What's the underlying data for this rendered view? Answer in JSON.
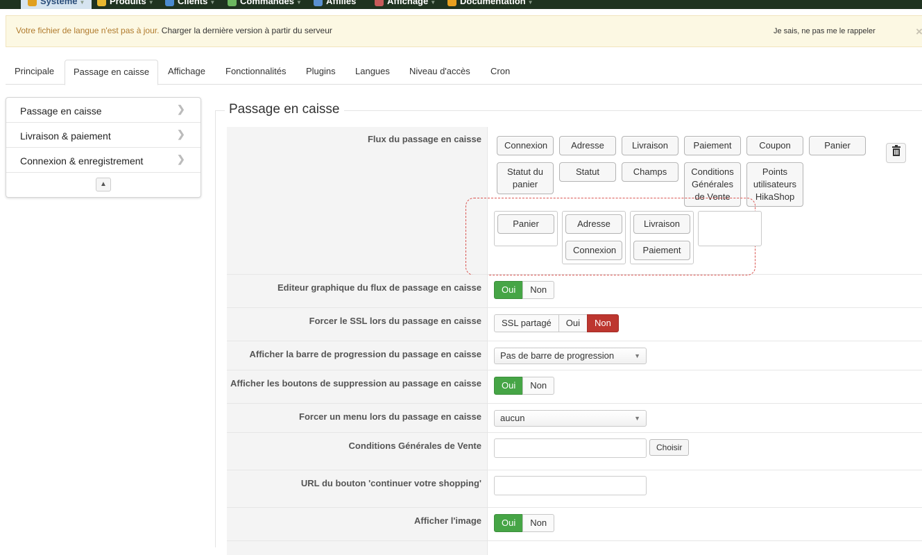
{
  "topmenu": [
    {
      "label": "Système",
      "color": "#e0a020"
    },
    {
      "label": "Produits",
      "color": "#e8b830"
    },
    {
      "label": "Clients",
      "color": "#4a8ad0"
    },
    {
      "label": "Commandes",
      "color": "#6cb860"
    },
    {
      "label": "Affiliés",
      "color": "#5a90d0"
    },
    {
      "label": "Affichage",
      "color": "#c85a5a"
    },
    {
      "label": "Documentation",
      "color": "#e8a020"
    }
  ],
  "alert": {
    "msg_highlight": "Votre fichier de langue n'est pas à jour.",
    "msg_rest": " Charger la dernière version à partir du serveur",
    "dismiss": "Je sais, ne pas me le rappeler",
    "close": "×"
  },
  "tabs": [
    "Principale",
    "Passage en caisse",
    "Affichage",
    "Fonctionnalités",
    "Plugins",
    "Langues",
    "Niveau d'accès",
    "Cron"
  ],
  "sidenav": {
    "items": [
      "Passage en caisse",
      "Livraison & paiement",
      "Connexion & enregistrement"
    ],
    "chevron": "❯",
    "collapse": "▲"
  },
  "section_title": "Passage en caisse",
  "flux": {
    "label": "Flux du passage en caisse",
    "palette_row1": [
      "Connexion",
      "Adresse",
      "Livraison",
      "Paiement",
      "Coupon",
      "Panier"
    ],
    "palette_row2": [
      "Statut du panier",
      "Statut",
      "Champs",
      "Conditions Générales de Vente",
      "Points utilisateurs HikaShop"
    ],
    "steps": {
      "step1": [
        "Panier"
      ],
      "step2": [
        "Adresse",
        "Connexion"
      ],
      "step3": [
        "Livraison",
        "Paiement"
      ]
    }
  },
  "rows": {
    "editeur": {
      "label": "Editeur graphique du flux de passage en caisse",
      "options": [
        "Oui",
        "Non"
      ],
      "active": "Oui"
    },
    "ssl": {
      "label": "Forcer le SSL lors du passage en caisse",
      "options": [
        "SSL partagé",
        "Oui",
        "Non"
      ],
      "active": "Non"
    },
    "progression": {
      "label": "Afficher la barre de progression du passage en caisse",
      "value": "Pas de barre de progression"
    },
    "suppression": {
      "label": "Afficher les boutons de suppression au passage en caisse",
      "options": [
        "Oui",
        "Non"
      ],
      "active": "Oui"
    },
    "menu": {
      "label": "Forcer un menu lors du passage en caisse",
      "value": "aucun"
    },
    "cgv": {
      "label": "Conditions Générales de Vente",
      "value": "",
      "button": "Choisir"
    },
    "url": {
      "label": "URL du bouton 'continuer votre shopping'",
      "value": ""
    },
    "image": {
      "label": "Afficher l'image",
      "options": [
        "Oui",
        "Non"
      ],
      "active": "Oui"
    }
  },
  "colors": {
    "green": "#46a546",
    "red": "#bd362f",
    "alert_bg": "#fcf8e3",
    "menubar": "#1f3320"
  }
}
